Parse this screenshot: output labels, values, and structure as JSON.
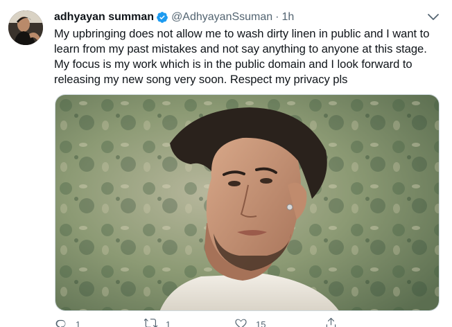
{
  "tweet": {
    "author": {
      "display_name": "adhyayan summan",
      "handle": "@AdhyayanSsuman",
      "separator": "·",
      "timestamp": "1h",
      "verified": true
    },
    "text_lines": [
      "My upbringing does not allow me to wash dirty linen in public and I want to",
      "learn from my past mistakes and not say anything to anyone at this stage.",
      "My focus is my work which is in the public domain and I look forward to",
      "releasing my new song very soon. Respect my privacy pls"
    ],
    "actions": {
      "reply_count": "1",
      "retweet_count": "1",
      "like_count": "15"
    }
  },
  "colors": {
    "accent": "#1d9bf0",
    "text_primary": "#0f1419",
    "text_secondary": "#536471",
    "border": "#cfd9de"
  },
  "icons": [
    "verified-badge-icon",
    "caret-down-icon",
    "reply-icon",
    "retweet-icon",
    "like-icon",
    "share-icon"
  ]
}
